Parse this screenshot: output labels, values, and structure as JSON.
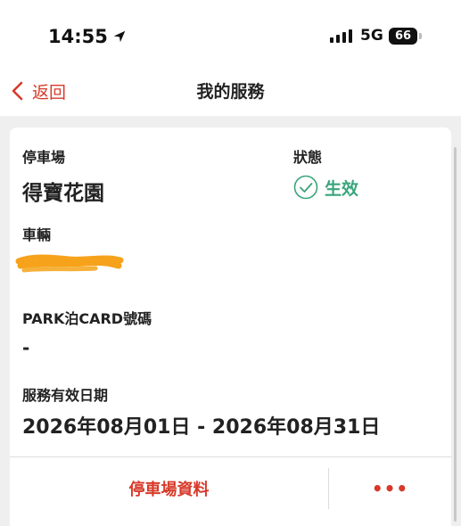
{
  "status_bar": {
    "time": "14:55",
    "network": "5G",
    "battery": "66"
  },
  "nav": {
    "back_label": "返回",
    "title": "我的服務"
  },
  "service": {
    "carpark_label": "停車場",
    "carpark_value": "得寶花園",
    "status_label": "狀態",
    "status_value": "生效",
    "vehicle_label": "車輛",
    "parkcard_label": "PARK泊CARD號碼",
    "parkcard_value": "-",
    "validity_label": "服務有效日期",
    "validity_value": "2026年08月01日 - 2026年08月31日"
  },
  "actions": {
    "carpark_info": "停車場資料",
    "more": "•••"
  },
  "colors": {
    "accent_red": "#d73a2a",
    "status_green": "#3aa57c",
    "redaction_orange": "#f7a21b"
  }
}
